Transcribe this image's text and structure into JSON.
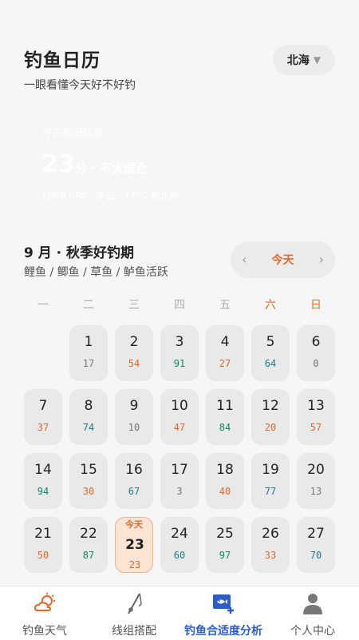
{
  "header": {
    "title": "钓鱼日历",
    "subtitle": "一眼看懂今天好不好钓",
    "city": "北海",
    "city_arrow": "▼"
  },
  "hero": {
    "label": "今天钓况指数",
    "score": "23",
    "level": "分 · 不太适合",
    "detail": "1008 hPa · 多云 · 17°C 东北风"
  },
  "month": {
    "title": "9 月 · 秋季好钓期",
    "fish": "鲤鱼 / 鲫鱼 / 草鱼 / 鲈鱼活跃"
  },
  "nav": {
    "prev": "‹",
    "today": "今天",
    "next": "›"
  },
  "weekdays": [
    "一",
    "二",
    "三",
    "四",
    "五",
    "六",
    "日"
  ],
  "calendar": {
    "today_tag": "今天",
    "days": [
      {
        "day": "1",
        "score": "17",
        "color": "gray"
      },
      {
        "day": "2",
        "score": "54",
        "color": "orange"
      },
      {
        "day": "3",
        "score": "91",
        "color": "green"
      },
      {
        "day": "4",
        "score": "27",
        "color": "orange"
      },
      {
        "day": "5",
        "score": "64",
        "color": "teal"
      },
      {
        "day": "6",
        "score": "0",
        "color": "gray"
      },
      {
        "day": "7",
        "score": "37",
        "color": "orange"
      },
      {
        "day": "8",
        "score": "74",
        "color": "teal"
      },
      {
        "day": "9",
        "score": "10",
        "color": "gray"
      },
      {
        "day": "10",
        "score": "47",
        "color": "orange"
      },
      {
        "day": "11",
        "score": "84",
        "color": "green"
      },
      {
        "day": "12",
        "score": "20",
        "color": "orange"
      },
      {
        "day": "13",
        "score": "57",
        "color": "orange"
      },
      {
        "day": "14",
        "score": "94",
        "color": "green"
      },
      {
        "day": "15",
        "score": "30",
        "color": "orange"
      },
      {
        "day": "16",
        "score": "67",
        "color": "teal"
      },
      {
        "day": "17",
        "score": "3",
        "color": "gray"
      },
      {
        "day": "18",
        "score": "40",
        "color": "orange"
      },
      {
        "day": "19",
        "score": "77",
        "color": "teal"
      },
      {
        "day": "20",
        "score": "13",
        "color": "gray"
      },
      {
        "day": "21",
        "score": "50",
        "color": "orange"
      },
      {
        "day": "22",
        "score": "87",
        "color": "green"
      },
      {
        "day": "23",
        "score": "23",
        "color": "orange",
        "today": true
      },
      {
        "day": "24",
        "score": "60",
        "color": "teal"
      },
      {
        "day": "25",
        "score": "97",
        "color": "green"
      },
      {
        "day": "26",
        "score": "33",
        "color": "orange"
      },
      {
        "day": "27",
        "score": "70",
        "color": "teal"
      }
    ]
  },
  "tabbar": {
    "items": [
      {
        "label": "钓鱼天气",
        "icon": "weather-icon",
        "active": false
      },
      {
        "label": "线组搭配",
        "icon": "fishing-rod-icon",
        "active": false
      },
      {
        "label": "钓鱼合适度分析",
        "icon": "fish-analysis-icon",
        "active": true
      },
      {
        "label": "个人中心",
        "icon": "person-icon",
        "active": false
      }
    ]
  },
  "colors": {
    "accent": "#e0692a",
    "active_tab": "#2b5cc7",
    "score_green": "#0d8a6a",
    "score_teal": "#1f7c8c",
    "score_gray": "#777777"
  }
}
